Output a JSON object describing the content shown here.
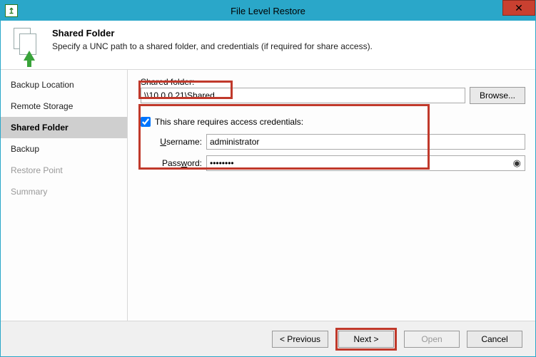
{
  "window": {
    "title": "File Level Restore",
    "close_glyph": "✕",
    "sys_glyph": "↥"
  },
  "header": {
    "title": "Shared Folder",
    "desc": "Specify a UNC path to a shared folder, and credentials (if required for share access)."
  },
  "sidebar": {
    "items": [
      {
        "label": "Backup Location",
        "state": "done"
      },
      {
        "label": "Remote Storage",
        "state": "done"
      },
      {
        "label": "Shared Folder",
        "state": "active"
      },
      {
        "label": "Backup",
        "state": "done"
      },
      {
        "label": "Restore Point",
        "state": "pending"
      },
      {
        "label": "Summary",
        "state": "pending"
      }
    ]
  },
  "form": {
    "shared_label": "Shared folder:",
    "shared_value": "\\\\10.0.0.21\\Shared",
    "browse_label": "Browse...",
    "cred_checkbox_label": "This share requires access credentials:",
    "cred_checkbox_checked": true,
    "username_label_pre": "U",
    "username_label_post": "sername:",
    "username_value": "administrator",
    "password_label_pre": "Pass",
    "password_label_u": "w",
    "password_label_post": "ord:",
    "password_value": "••••••••"
  },
  "footer": {
    "previous": "< Previous",
    "next": "Next >",
    "open": "Open",
    "cancel": "Cancel"
  }
}
